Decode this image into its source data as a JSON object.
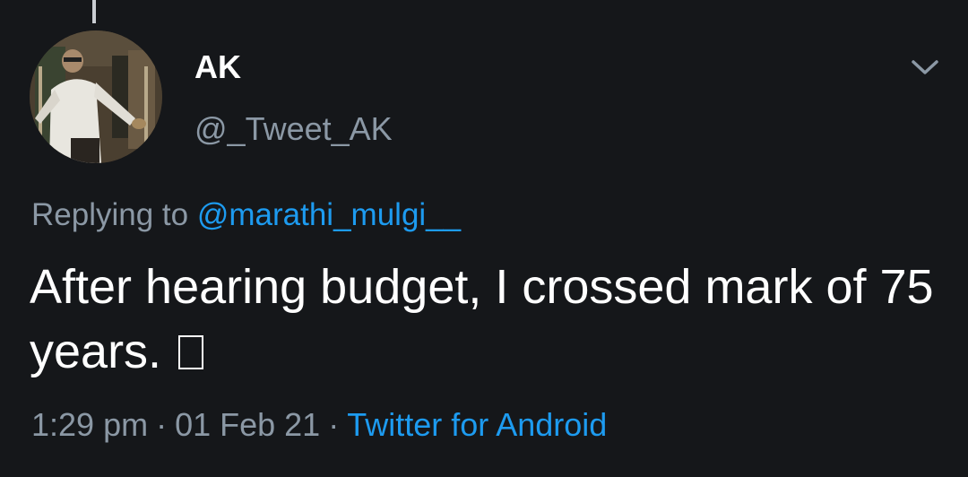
{
  "tweet": {
    "author": {
      "display_name": "AK",
      "handle": "@_Tweet_AK",
      "avatar_icon": "user-photo"
    },
    "reply": {
      "prefix": "Replying to",
      "mention": "@marathi_mulgi__"
    },
    "text": "After hearing budget, I crossed mark of 75 years.",
    "emoji_placeholder": "missing-glyph-box",
    "time": "1:29 pm",
    "separator": "·",
    "date": "01 Feb 21",
    "source": "Twitter for Android",
    "menu_icon": "chevron-down-icon"
  },
  "colors": {
    "background": "#15171a",
    "primary_text": "#ffffff",
    "secondary_text": "#8b98a5",
    "link": "#1d9bf0"
  }
}
